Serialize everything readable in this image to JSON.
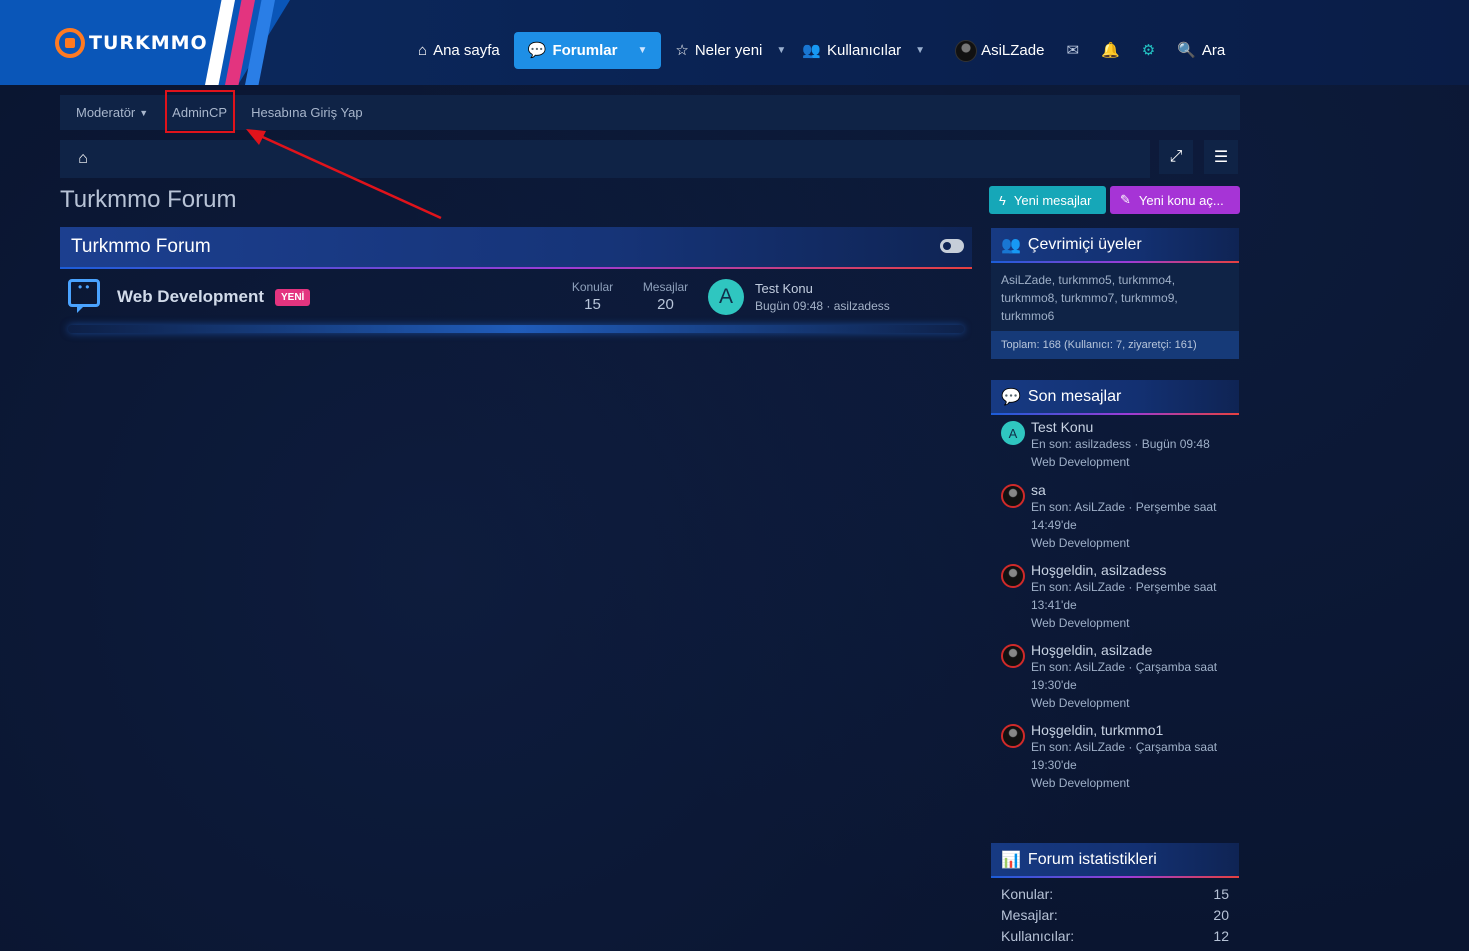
{
  "logo": {
    "text": "TURKMMO"
  },
  "nav": {
    "home": "Ana sayfa",
    "forums": "Forumlar",
    "whats_new": "Neler yeni",
    "members": "Kullanıcılar",
    "username": "AsiLZade",
    "search": "Ara"
  },
  "subnav": {
    "moderator": "Moderatör",
    "admincp": "AdminCP",
    "login_as": "Hesabına Giriş Yap"
  },
  "page": {
    "title": "Turkmmo Forum"
  },
  "buttons": {
    "new_posts": "Yeni mesajlar",
    "new_thread": "Yeni konu aç..."
  },
  "forum_block": {
    "title": "Turkmmo Forum",
    "node": {
      "name": "Web Development",
      "badge": "YENİ",
      "threads_label": "Konular",
      "threads": "15",
      "posts_label": "Mesajlar",
      "posts": "20",
      "last_avatar": "A",
      "last_title": "Test Konu",
      "last_meta": "Bugün 09:48 · asilzadess"
    }
  },
  "online": {
    "title": "Çevrimiçi üyeler",
    "list": "AsiLZade, turkmmo5, turkmmo4, turkmmo8, turkmmo7, turkmmo9, turkmmo6",
    "total": "Toplam: 168 (Kullanıcı: 7, ziyaretçi: 161)"
  },
  "recent": {
    "title": "Son mesajlar",
    "items": [
      {
        "title": "Test Konu",
        "meta": "En son: asilzadess · Bugün 09:48",
        "forum": "Web Development",
        "avatar": "A"
      },
      {
        "title": "sa",
        "meta": "En son: AsiLZade · Perşembe saat 14:49'de",
        "forum": "Web Development"
      },
      {
        "title": "Hoşgeldin, asilzadess",
        "meta": "En son: AsiLZade · Perşembe saat 13:41'de",
        "forum": "Web Development"
      },
      {
        "title": "Hoşgeldin, asilzade",
        "meta": "En son: AsiLZade · Çarşamba saat 19:30'de",
        "forum": "Web Development"
      },
      {
        "title": "Hoşgeldin, turkmmo1",
        "meta": "En son: AsiLZade · Çarşamba saat 19:30'de",
        "forum": "Web Development"
      }
    ]
  },
  "stats": {
    "title": "Forum istatistikleri",
    "rows": [
      {
        "label": "Konular:",
        "value": "15"
      },
      {
        "label": "Mesajlar:",
        "value": "20"
      },
      {
        "label": "Kullanıcılar:",
        "value": "12"
      }
    ]
  },
  "colors": {
    "accent": "#1e8fe6",
    "new_posts": "#16a7b8",
    "new_thread": "#a634d6",
    "badge": "#e3347f",
    "annotation": "#e0131b"
  }
}
